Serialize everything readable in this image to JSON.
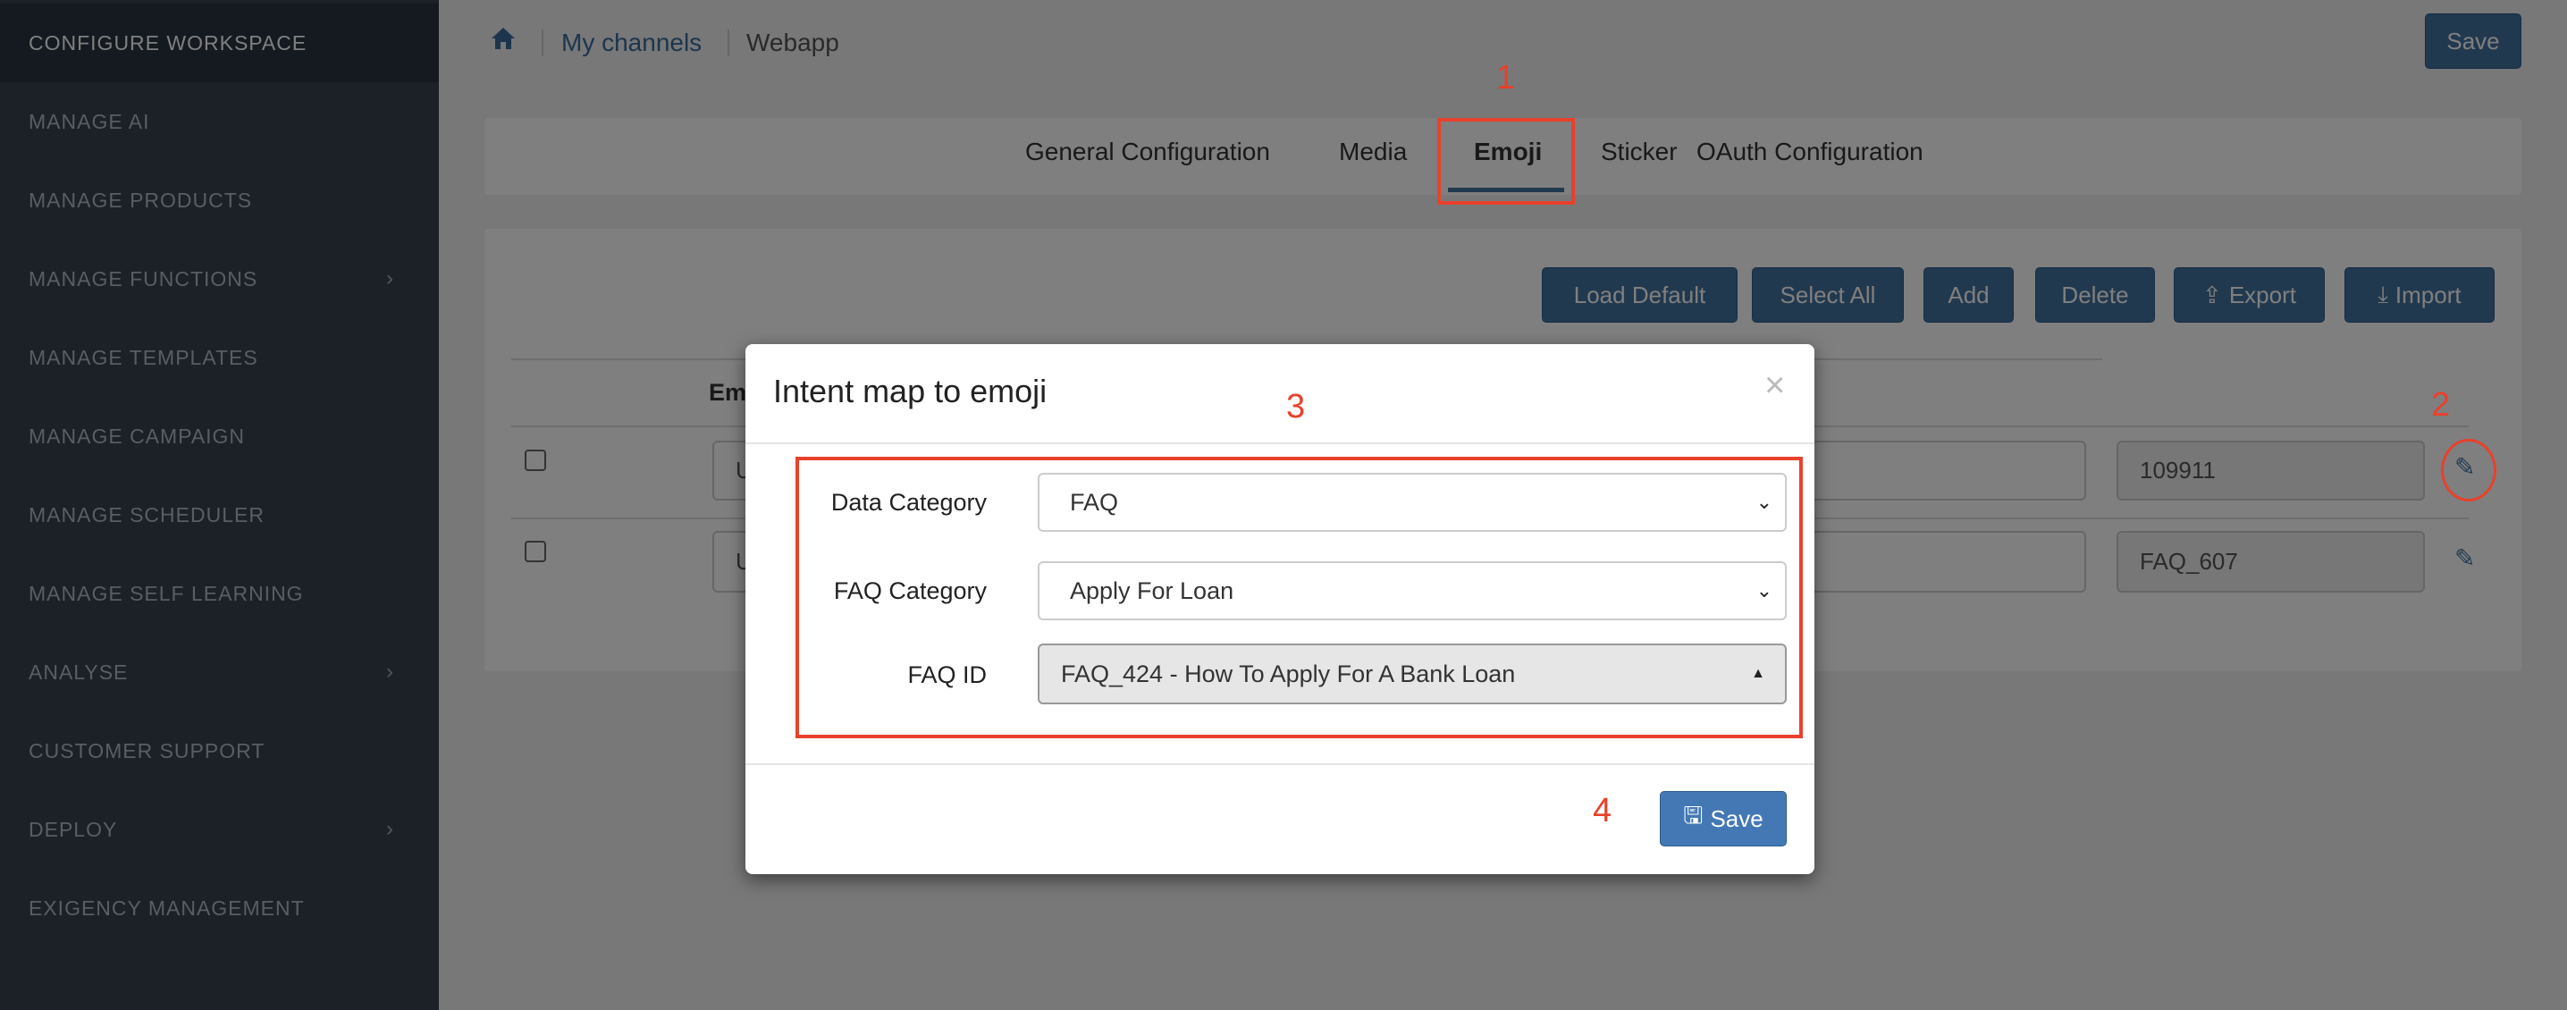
{
  "sidebar": {
    "items": [
      {
        "label": "CONFIGURE WORKSPACE",
        "active": true
      },
      {
        "label": "MANAGE AI"
      },
      {
        "label": "MANAGE PRODUCTS"
      },
      {
        "label": "MANAGE FUNCTIONS",
        "has_submenu": true
      },
      {
        "label": "MANAGE TEMPLATES"
      },
      {
        "label": "MANAGE CAMPAIGN"
      },
      {
        "label": "MANAGE SCHEDULER"
      },
      {
        "label": "MANAGE SELF LEARNING"
      },
      {
        "label": "ANALYSE",
        "has_submenu": true
      },
      {
        "label": "CUSTOMER SUPPORT"
      },
      {
        "label": "DEPLOY",
        "has_submenu": true
      },
      {
        "label": "EXIGENCY MANAGEMENT"
      }
    ]
  },
  "breadcrumb": {
    "home_icon": "home-icon",
    "channels": "My channels",
    "current": "Webapp"
  },
  "header": {
    "save_label": "Save"
  },
  "tabs": [
    {
      "label": "General Configuration"
    },
    {
      "label": "Media"
    },
    {
      "label": "Emoji",
      "active": true
    },
    {
      "label": "Sticker"
    },
    {
      "label": "OAuth Configuration"
    }
  ],
  "toolbar": {
    "load_default": "Load Default",
    "select_all": "Select All",
    "add": "Add",
    "delete": "Delete",
    "export": "Export",
    "import": "Import"
  },
  "table": {
    "header_partial": "Em",
    "rows": [
      {
        "col1_partial": "U",
        "id": "109911"
      },
      {
        "col1_partial": "U",
        "id": "FAQ_607"
      }
    ]
  },
  "modal": {
    "title": "Intent map to emoji",
    "close": "×",
    "fields": [
      {
        "label": "Data Category",
        "value": "FAQ"
      },
      {
        "label": "FAQ Category",
        "value": "Apply For Loan"
      },
      {
        "label": "FAQ ID",
        "value": "FAQ_424 - How To Apply For A Bank Loan"
      }
    ],
    "save_label": "Save"
  },
  "annotations": {
    "a1": "1",
    "a2": "2",
    "a3": "3",
    "a4": "4"
  },
  "colors": {
    "accent": "#42739f",
    "annotation": "#e8412c",
    "sidebar": "#36424f"
  }
}
